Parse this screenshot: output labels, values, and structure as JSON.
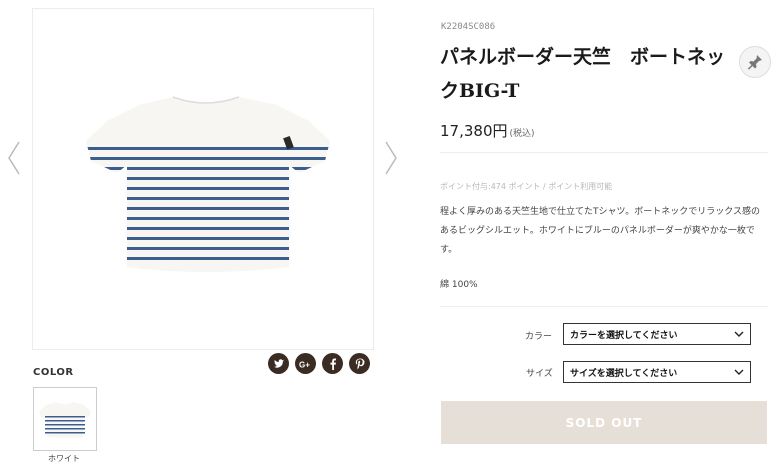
{
  "product": {
    "sku": "K2204SC086",
    "title": "パネルボーダー天竺　ボートネックBIG-T",
    "price": "17,380円",
    "tax_note": "(税込)",
    "points": "ポイント付与:474 ポイント / ポイント利用可能",
    "description": "程よく厚みのある天竺生地で仕立てたTシャツ。ボートネックでリラックス感のあるビッグシルエット。ホワイトにブルーのパネルボーダーが爽やかな一枚です。",
    "material": "綿 100%"
  },
  "gallery": {
    "main_image": "striped-boatneck-tshirt-photo",
    "prev_icon": "chevron-left-icon",
    "next_icon": "chevron-right-icon"
  },
  "social": [
    "twitter-icon",
    "google-plus-icon",
    "facebook-icon",
    "pinterest-icon"
  ],
  "color_section": {
    "label": "COLOR",
    "swatches": [
      {
        "caption": "ホワイト"
      }
    ]
  },
  "options": {
    "color_label": "カラー",
    "color_select": "カラーを選択してください",
    "size_label": "サイズ",
    "size_select": "サイズを選択してください"
  },
  "sold_out_label": "SOLD OUT",
  "colors": {
    "stripe_blue": "#3c5e8f",
    "shirt_white": "#f7f6f2",
    "sold_out_bg": "#e6dfd7",
    "social_bg": "#3a2c22"
  }
}
